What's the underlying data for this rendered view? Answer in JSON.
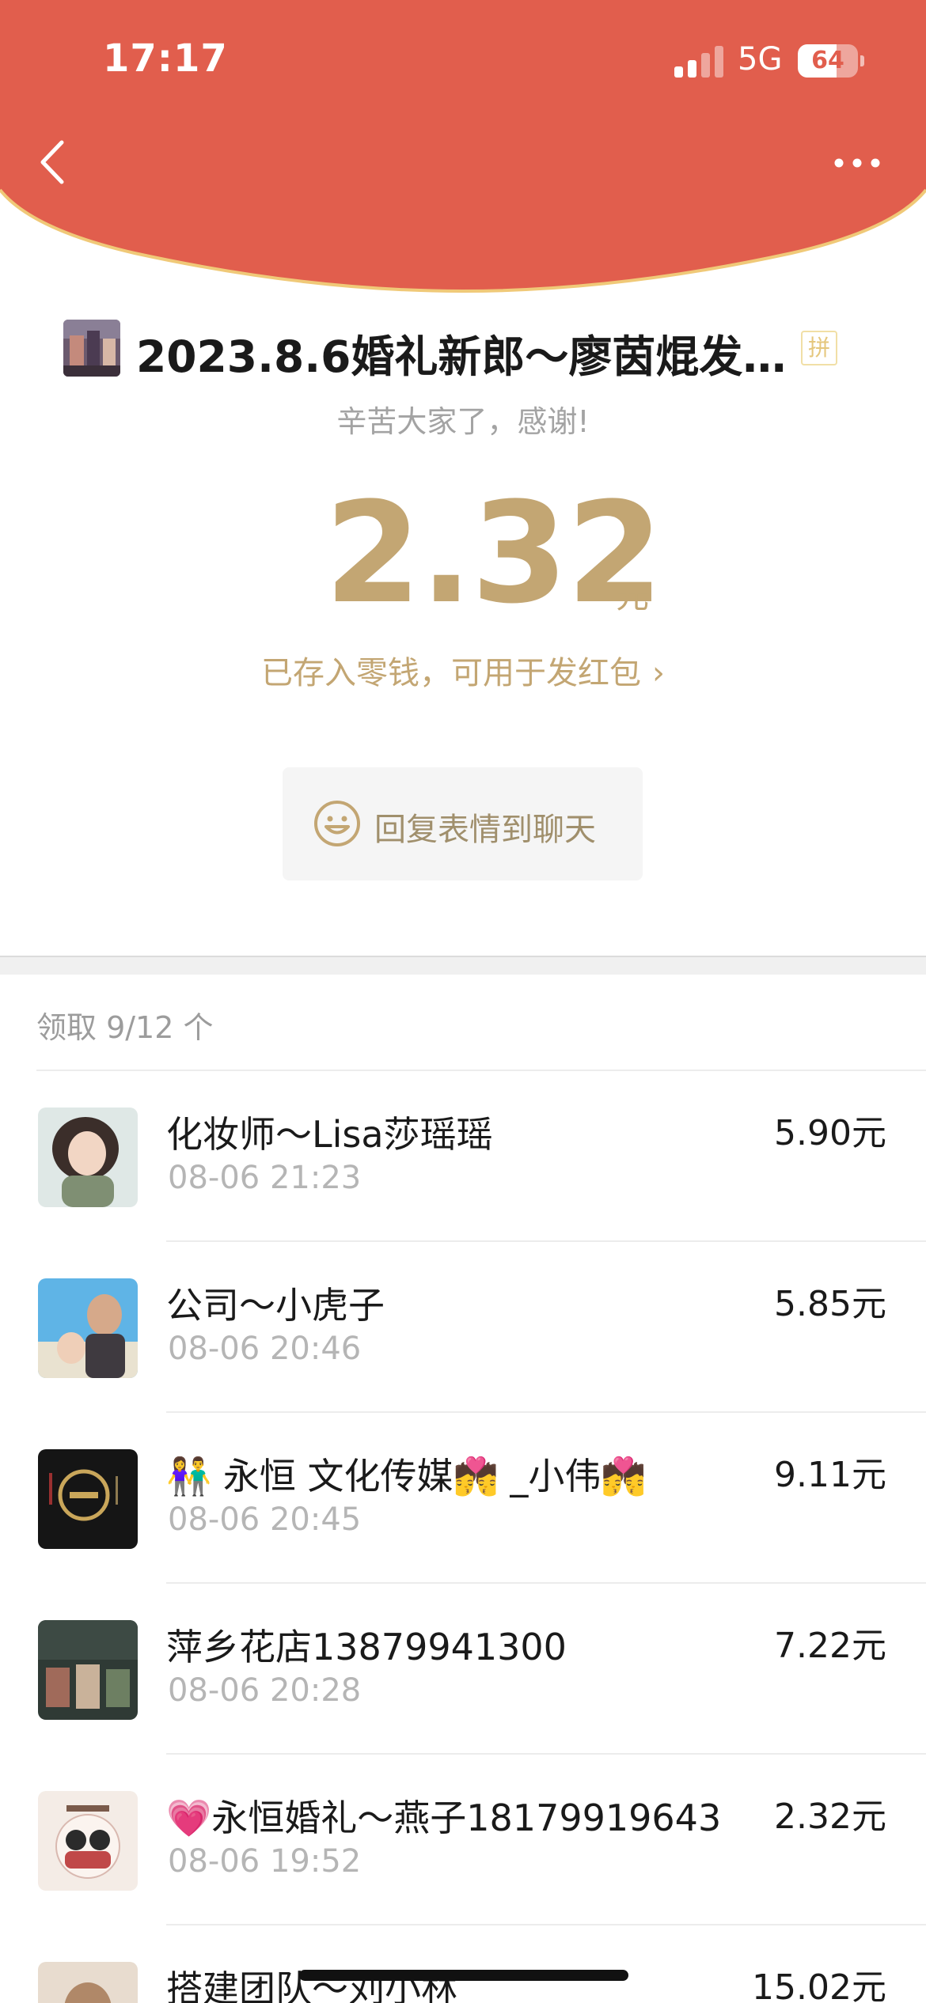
{
  "status_bar": {
    "time": "17:17",
    "network": "5G",
    "battery": "64",
    "battery_level": 0.64
  },
  "colors": {
    "header_red": "#e15e4d",
    "gold": "#c3a673",
    "header_rim": "#f0c978"
  },
  "icons": {
    "back": "chevron-left-icon",
    "more": "more-dots-icon",
    "smile": "smile-icon",
    "signal": "signal-icon",
    "battery": "battery-icon"
  },
  "envelope": {
    "sender_name": "2023.8.6婚礼新郎～廖茵焜发…",
    "pin_badge": "拼",
    "blessing": "辛苦大家了，感谢!",
    "amount": "2.32",
    "unit": "元",
    "stored_text": "已存入零钱，可用于发红包",
    "stored_chevron": "›",
    "reply_label": "回复表情到聊天"
  },
  "receivers": {
    "count_label": "领取 9/12 个",
    "items": [
      {
        "name": "化妆师～Lisa莎瑶瑶",
        "time": "08-06 21:23",
        "amount": "5.90元"
      },
      {
        "name": "公司～小虎子",
        "time": "08-06 20:46",
        "amount": "5.85元"
      },
      {
        "name": "👫 永恒 文化传媒💏 _小伟💏",
        "time": "08-06 20:45",
        "amount": "9.11元"
      },
      {
        "name": "萍乡花店13879941300",
        "time": "08-06 20:28",
        "amount": "7.22元"
      },
      {
        "name": "💗永恒婚礼～燕子18179919643",
        "time": "08-06 19:52",
        "amount": "2.32元"
      },
      {
        "name": "搭建团队～刘小林",
        "time": "",
        "amount": "15.02元"
      }
    ]
  }
}
